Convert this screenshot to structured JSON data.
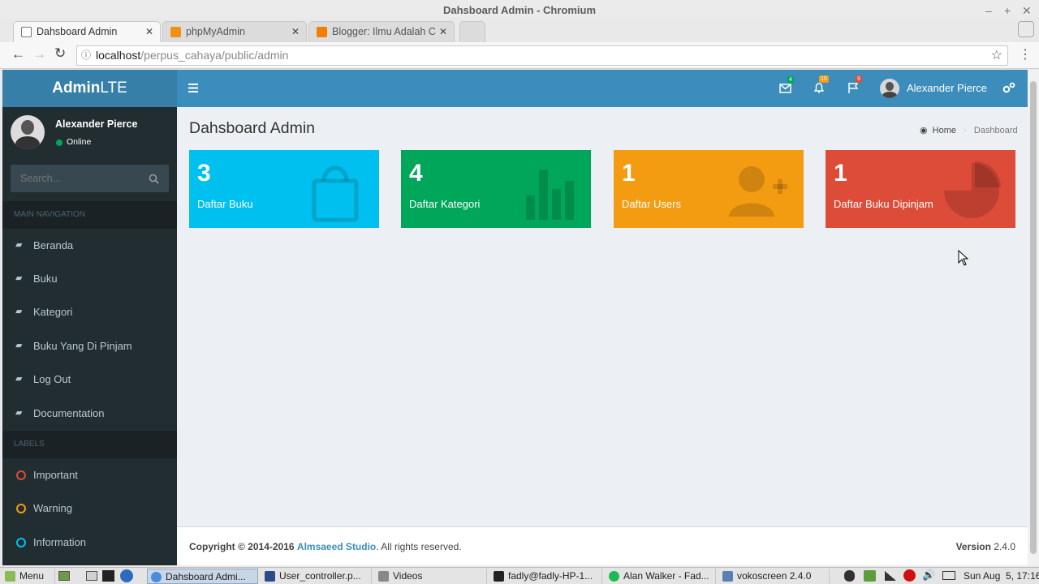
{
  "window": {
    "title": "Dahsboard Admin - Chromium"
  },
  "browser": {
    "tabs": [
      {
        "label": "Dahsboard Admin",
        "active": true
      },
      {
        "label": "phpMyAdmin",
        "active": false
      },
      {
        "label": "Blogger: Ilmu Adalah C",
        "active": false
      }
    ],
    "url_host": "localhost",
    "url_path": "/perpus_cahaya/public/admin"
  },
  "app": {
    "logo_bold": "Admin",
    "logo_light": "LTE",
    "navbar": {
      "messages_badge": "4",
      "notifications_badge": "10",
      "tasks_badge": "9",
      "user_name": "Alexander Pierce"
    },
    "sidebar": {
      "user_name": "Alexander Pierce",
      "status": "Online",
      "search_placeholder": "Search...",
      "main_header": "MAIN NAVIGATION",
      "items": [
        {
          "label": "Beranda"
        },
        {
          "label": "Buku"
        },
        {
          "label": "Kategori"
        },
        {
          "label": "Buku Yang Di Pinjam"
        },
        {
          "label": "Log Out"
        },
        {
          "label": "Documentation"
        }
      ],
      "labels_header": "LABELS",
      "labels": [
        {
          "label": "Important",
          "color": "#dd4b39"
        },
        {
          "label": "Warning",
          "color": "#f39c12"
        },
        {
          "label": "Information",
          "color": "#00c0ef"
        }
      ]
    },
    "content": {
      "title": "Dahsboard Admin",
      "breadcrumb_home": "Home",
      "breadcrumb_current": "Dashboard",
      "boxes": [
        {
          "number": "3",
          "label": "Daftar Buku",
          "color": "#00c0ef",
          "icon": "shopping-bag-icon"
        },
        {
          "number": "4",
          "label": "Daftar Kategori",
          "color": "#00a65a",
          "icon": "bar-chart-icon"
        },
        {
          "number": "1",
          "label": "Daftar Users",
          "color": "#f39c12",
          "icon": "person-add-icon"
        },
        {
          "number": "1",
          "label": "Daftar Buku Dipinjam",
          "color": "#dd4b39",
          "icon": "pie-chart-icon"
        }
      ]
    },
    "footer": {
      "copyright": "Copyright © 2014-2016",
      "studio": "Almsaeed Studio",
      "rights": ". All rights reserved.",
      "version_label": "Version",
      "version": "2.4.0"
    }
  },
  "taskbar": {
    "menu": "Menu",
    "tasks": [
      {
        "label": "Dahsboard Admi..."
      },
      {
        "label": "User_controller.p..."
      },
      {
        "label": "Videos"
      },
      {
        "label": "fadly@fadly-HP-1..."
      },
      {
        "label": "Alan Walker - Fad..."
      },
      {
        "label": "vokoscreen 2.4.0"
      }
    ],
    "clock": "Sun Aug  5, 17:16"
  }
}
